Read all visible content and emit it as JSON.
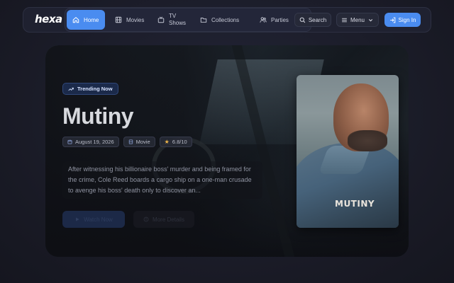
{
  "brand": {
    "logo_text": "hexa"
  },
  "nav": {
    "items": [
      {
        "label": "Home",
        "icon": "home-icon",
        "active": true
      },
      {
        "label": "Movies",
        "icon": "film-icon",
        "active": false
      },
      {
        "label": "TV Shows",
        "icon": "tv-icon",
        "active": false
      },
      {
        "label": "Collections",
        "icon": "folder-icon",
        "active": false
      },
      {
        "label": "Parties",
        "icon": "users-icon",
        "active": false
      }
    ],
    "search_label": "Search",
    "menu_label": "Menu",
    "signin_label": "Sign In"
  },
  "hero": {
    "badge": "Trending Now",
    "title": "Mutiny",
    "date": "August 19, 2026",
    "type": "Movie",
    "rating": "6.8/10",
    "description": "After witnessing his billionaire boss' murder and being framed for the crime, Cole Reed boards a cargo ship on a one-man crusade to avenge his boss' death only to discover an...",
    "watch_label": "Watch Now",
    "details_label": "More Details",
    "poster_title": "MUTINY"
  },
  "colors": {
    "accent": "#4a8cf0",
    "background": "#1a1b26",
    "star": "#f2b84b"
  }
}
